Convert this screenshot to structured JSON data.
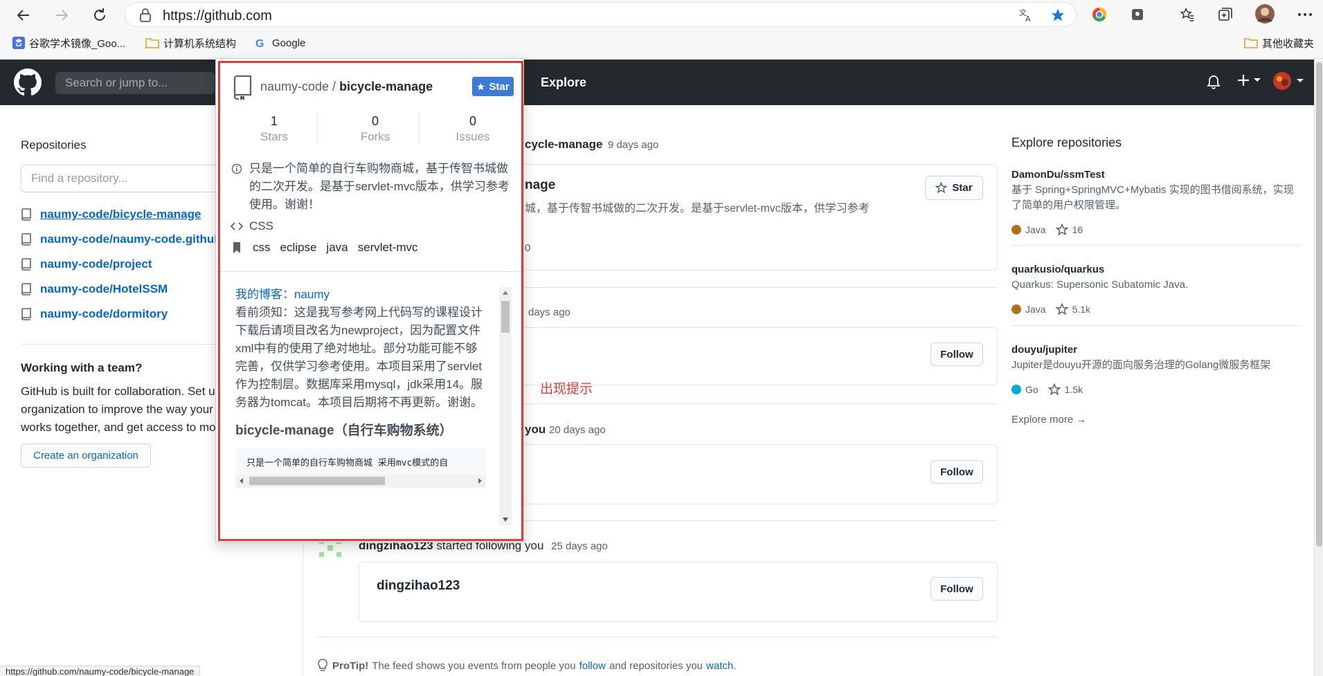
{
  "browser": {
    "url": "https://github.com",
    "bookmarks": [
      "谷歌学术镜像_Goo...",
      "计算机系统结构",
      "Google"
    ],
    "other_bookmarks": "其他收藏夹"
  },
  "github": {
    "search_placeholder": "Search or jump to...",
    "nav_explore": "Explore"
  },
  "left": {
    "repositories_title": "Repositories",
    "find_placeholder": "Find a repository...",
    "repos": [
      "naumy-code/bicycle-manage",
      "naumy-code/naumy-code.github.io",
      "naumy-code/project",
      "naumy-code/HotelSSM",
      "naumy-code/dormitory"
    ],
    "team_title": "Working with a team?",
    "team_text_1": "GitHub is built for collaboration. Set up an",
    "team_text_2": "organization to improve the way your team",
    "team_text_3": "works together, and get access to more features.",
    "create_org": "Create an organization"
  },
  "feed": {
    "item1_fragment": "cycle-manage",
    "item1_time": "9 days ago",
    "item1_title_fragment": "nage",
    "item1_desc": "城，基于传智书城做的二次开发。是基于servlet-mvc版本，供学习参考",
    "item1_stat_fragment": "0",
    "star_label": "Star",
    "item2_time": "days ago",
    "item3_fragment": "you",
    "item3_time": "20 days ago",
    "item4_user": "dingzihao123",
    "item4_action": "started following you",
    "item4_time": "25 days ago",
    "item4_card_name": "dingzihao123",
    "follow_label": "Follow",
    "annotation": "出现提示",
    "protip_label": "ProTip!",
    "protip_text_1": "The feed shows you events from people you",
    "protip_follow": "follow",
    "protip_text_2": "and repositories you",
    "protip_watch": "watch",
    "protip_end": "."
  },
  "explore": {
    "title": "Explore repositories",
    "repos": [
      {
        "name": "DamonDu/ssmTest",
        "desc": "基于 Spring+SpringMVC+Mybatis 实现的图书借阅系统，实现了简单的用户权限管理。",
        "lang": "Java",
        "lang_color": "#b07219",
        "stars": "16"
      },
      {
        "name": "quarkusio/quarkus",
        "desc": "Quarkus: Supersonic Subatomic Java.",
        "lang": "Java",
        "lang_color": "#b07219",
        "stars": "5.1k"
      },
      {
        "name": "douyu/jupiter",
        "desc": "Jupiter是douyu开源的面向服务治理的Golang微服务框架",
        "lang": "Go",
        "lang_color": "#00ADD8",
        "stars": "1.5k"
      }
    ],
    "more": "Explore more →"
  },
  "popup": {
    "owner": "naumy-code / ",
    "repo": "bicycle-manage",
    "star_btn": "Star",
    "stars_n": "1",
    "stars_l": "Stars",
    "forks_n": "0",
    "forks_l": "Forks",
    "issues_n": "0",
    "issues_l": "Issues",
    "desc": "只是一个简单的自行车购物商城，基于传智书城做的二次开发。是基于servlet-mvc版本，供学习参考使用。谢谢！",
    "language": "CSS",
    "topics": [
      "css",
      "eclipse",
      "java",
      "servlet-mvc"
    ],
    "blog_label": "我的博客：",
    "blog_link": "naumy",
    "notice": "看前须知：这是我写参考网上代码写的课程设计 下载后请项目改名为newproject，因为配置文件xml中有的使用了绝对地址。部分功能可能不够完善，仅供学习参考使用。本项目采用了servlet作为控制层。数据库采用mysql，jdk采用14。服务器为tomcat。本项目后期将不再更新。谢谢。",
    "heading": "bicycle-manage（自行车购物系统）",
    "code": "只是一个简单的自行车购物商城 采用mvc模式的自"
  },
  "status_url": "https://github.com/naumy-code/bicycle-manage"
}
